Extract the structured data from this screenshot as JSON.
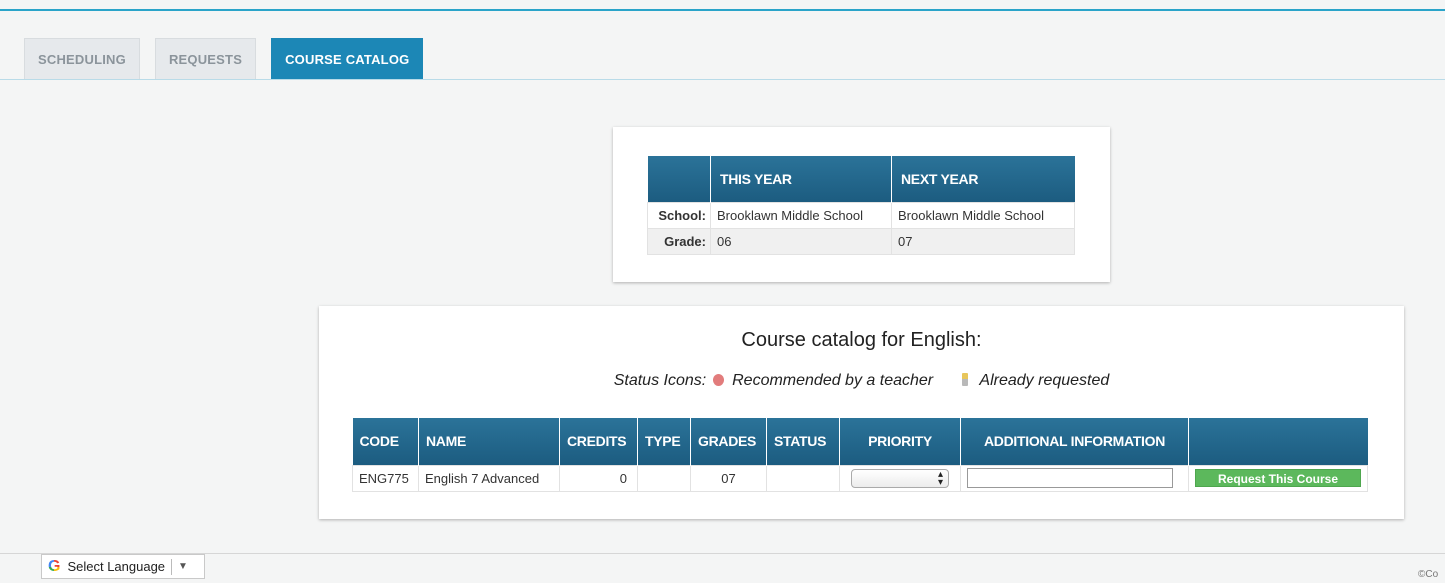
{
  "tabs": [
    {
      "label": "SCHEDULING"
    },
    {
      "label": "REQUESTS"
    },
    {
      "label": "COURSE CATALOG",
      "active": true
    }
  ],
  "year_info": {
    "headers": [
      "",
      "THIS YEAR",
      "NEXT YEAR"
    ],
    "rows": [
      {
        "label": "School:",
        "this_year": "Brooklawn Middle School",
        "next_year": "Brooklawn Middle School"
      },
      {
        "label": "Grade:",
        "this_year": "06",
        "next_year": "07"
      }
    ]
  },
  "catalog": {
    "title": "Course catalog for English:",
    "status_prefix": "Status Icons:",
    "status_recommended": "Recommended by a teacher",
    "status_requested": "Already requested",
    "icons": {
      "recommended": "apple-icon",
      "requested": "pencil-icon"
    },
    "headers": {
      "code": "CODE",
      "name": "NAME",
      "credits": "CREDITS",
      "type": "TYPE",
      "grades": "GRADES",
      "status": "STATUS",
      "priority": "PRIORITY",
      "additional_info": "ADDITIONAL INFORMATION",
      "action": ""
    },
    "courses": [
      {
        "code": "ENG775",
        "name": "English 7 Advanced",
        "credits": "0",
        "type": "",
        "grades": "07",
        "status": "",
        "priority": "",
        "additional_info": "",
        "action_label": "Request This Course"
      }
    ]
  },
  "footer": {
    "language_label": "Select Language",
    "language_arrow": "▼",
    "copyright": "©Co"
  },
  "colors": {
    "accent": "#2aa4c9",
    "active_tab": "#1c87b6",
    "header": "#1f6389",
    "button": "#5cb85c"
  }
}
